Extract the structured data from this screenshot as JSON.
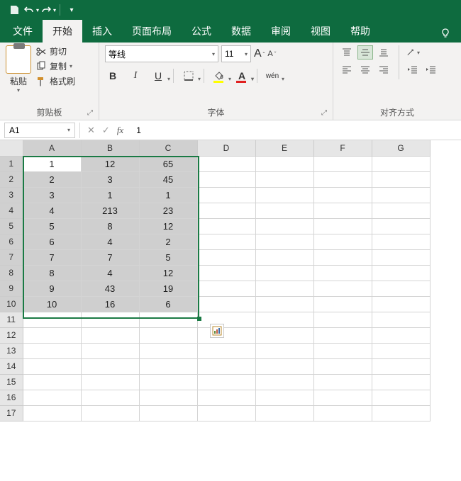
{
  "titlebar": {
    "save_icon": "save",
    "undo_icon": "undo",
    "redo_icon": "redo"
  },
  "tabs": {
    "items": [
      "文件",
      "开始",
      "插入",
      "页面布局",
      "公式",
      "数据",
      "审阅",
      "视图",
      "帮助"
    ],
    "active_index": 1
  },
  "ribbon": {
    "clipboard": {
      "paste_label": "粘贴",
      "cut_label": "剪切",
      "copy_label": "复制",
      "format_painter_label": "格式刷",
      "group_label": "剪贴板"
    },
    "font": {
      "font_name": "等线",
      "font_size": "11",
      "bold": "B",
      "italic": "I",
      "underline": "U",
      "wen": "wén",
      "a_char": "A",
      "group_label": "字体"
    },
    "align": {
      "group_label": "对齐方式"
    }
  },
  "namebox": {
    "value": "A1"
  },
  "formula": {
    "value": "1"
  },
  "grid": {
    "columns": [
      "A",
      "B",
      "C",
      "D",
      "E",
      "F",
      "G"
    ],
    "selected_cols": [
      0,
      1,
      2
    ],
    "row_count": 17,
    "selected_rows": [
      1,
      2,
      3,
      4,
      5,
      6,
      7,
      8,
      9,
      10
    ],
    "active_cell": "A1",
    "data": [
      [
        "1",
        "12",
        "65"
      ],
      [
        "2",
        "3",
        "45"
      ],
      [
        "3",
        "1",
        "1"
      ],
      [
        "4",
        "213",
        "23"
      ],
      [
        "5",
        "8",
        "12"
      ],
      [
        "6",
        "4",
        "2"
      ],
      [
        "7",
        "7",
        "5"
      ],
      [
        "8",
        "4",
        "12"
      ],
      [
        "9",
        "43",
        "19"
      ],
      [
        "10",
        "16",
        "6"
      ]
    ]
  },
  "chart_data": {
    "type": "table",
    "columns": [
      "A",
      "B",
      "C"
    ],
    "rows": [
      [
        1,
        12,
        65
      ],
      [
        2,
        3,
        45
      ],
      [
        3,
        1,
        1
      ],
      [
        4,
        213,
        23
      ],
      [
        5,
        8,
        12
      ],
      [
        6,
        4,
        2
      ],
      [
        7,
        7,
        5
      ],
      [
        8,
        4,
        12
      ],
      [
        9,
        43,
        19
      ],
      [
        10,
        16,
        6
      ]
    ]
  }
}
